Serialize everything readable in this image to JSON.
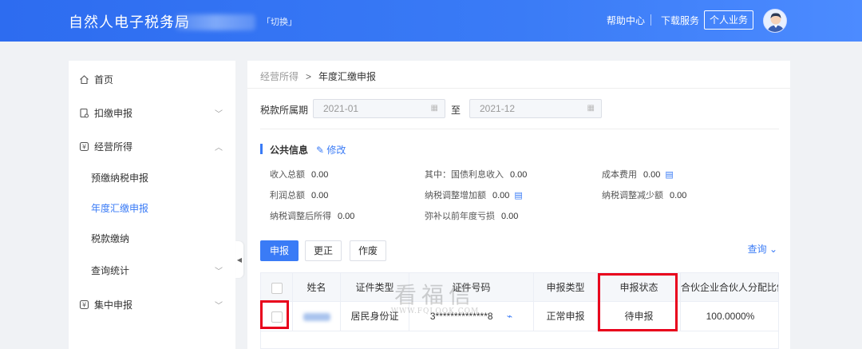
{
  "header": {
    "brand": "自然人电子税务局",
    "switch_label": "「切换」",
    "help": "帮助中心",
    "download": "下载服务",
    "personal": "个人业务"
  },
  "sidebar": {
    "items": [
      {
        "label": "首页"
      },
      {
        "label": "扣缴申报"
      },
      {
        "label": "经营所得"
      },
      {
        "label": "预缴纳税申报"
      },
      {
        "label": "年度汇缴申报"
      },
      {
        "label": "税款缴纳"
      },
      {
        "label": "查询统计"
      },
      {
        "label": "集中申报"
      }
    ]
  },
  "breadcrumb": {
    "parent": "经营所得",
    "sep": ">",
    "current": "年度汇缴申报"
  },
  "period": {
    "label": "税款所属期",
    "from": "2021-01",
    "to_label": "至",
    "to": "2021-12"
  },
  "public_info": {
    "title": "公共信息",
    "edit": "修改",
    "income_total": {
      "label": "收入总额",
      "value": "0.00"
    },
    "of_which": {
      "label": "其中：国债利息收入",
      "value": "0.00"
    },
    "cost": {
      "label": "成本费用",
      "value": "0.00"
    },
    "profit": {
      "label": "利润总额",
      "value": "0.00"
    },
    "adjust_inc": {
      "label": "纳税调整增加额",
      "value": "0.00"
    },
    "adjust_dec": {
      "label": "纳税调整减少额",
      "value": "0.00"
    },
    "after_adjust": {
      "label": "纳税调整后所得",
      "value": "0.00"
    },
    "loss": {
      "label": "弥补以前年度亏损",
      "value": "0.00"
    }
  },
  "actions": {
    "declare": "申报",
    "correct": "更正",
    "void": "作废",
    "query": "查询"
  },
  "table": {
    "headers": [
      "姓名",
      "证件类型",
      "证件号码",
      "申报类型",
      "申报状态",
      "合伙企业合伙人分配比例"
    ],
    "rows": [
      {
        "id_type": "居民身份证",
        "id_number": "3**************8",
        "declare_type": "正常申报",
        "status": "待申报",
        "ratio": "100.0000%"
      }
    ]
  },
  "watermark": {
    "main": "看福信",
    "url": "WWW.FQLOOK.COM"
  },
  "colors": {
    "brand": "#3a7bf6",
    "highlight": "#e8001c"
  }
}
